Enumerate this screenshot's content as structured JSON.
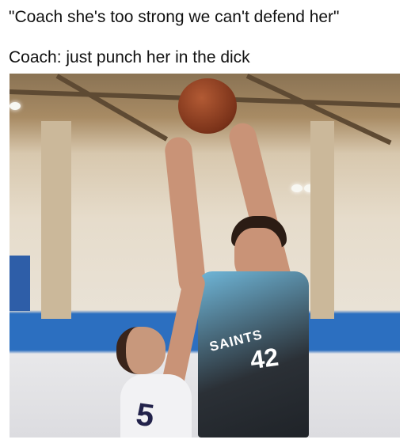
{
  "captions": {
    "line1": "\"Coach she's too strong we can't defend her\"",
    "line2": "Coach: just punch her in the dick"
  },
  "photo": {
    "jersey_team": "SAINTS",
    "jersey_number": "42",
    "defender_number": "5"
  }
}
